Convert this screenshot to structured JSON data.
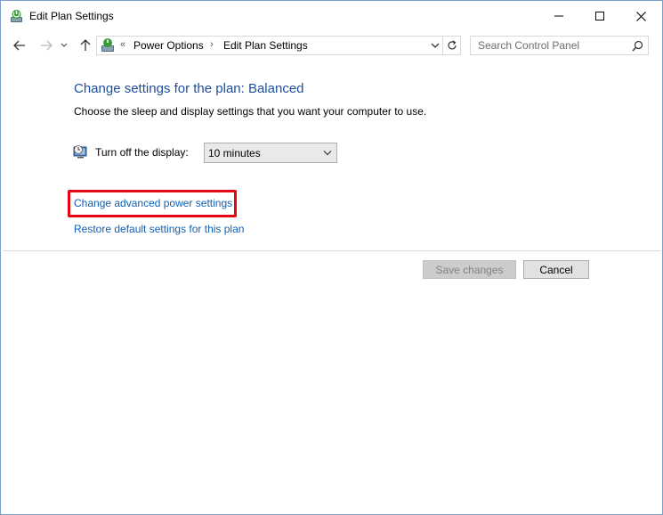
{
  "window": {
    "title": "Edit Plan Settings",
    "controls": {
      "minimize": "minimize-icon",
      "maximize": "maximize-icon",
      "close": "close-icon"
    }
  },
  "nav": {
    "breadcrumb_chevron": "«",
    "breadcrumb_sep": "›",
    "breadcrumbs": [
      "Power Options",
      "Edit Plan Settings"
    ],
    "search_placeholder": "Search Control Panel"
  },
  "content": {
    "heading": "Change settings for the plan: Balanced",
    "subtitle": "Choose the sleep and display settings that you want your computer to use.",
    "display": {
      "label": "Turn off the display:",
      "selected": "10 minutes"
    },
    "links": {
      "advanced": "Change advanced power settings",
      "restore": "Restore default settings for this plan"
    },
    "buttons": {
      "save": "Save changes",
      "cancel": "Cancel"
    }
  },
  "colors": {
    "heading": "#1e4e9a",
    "link": "#0f5fb4",
    "highlight": "#e30613"
  }
}
